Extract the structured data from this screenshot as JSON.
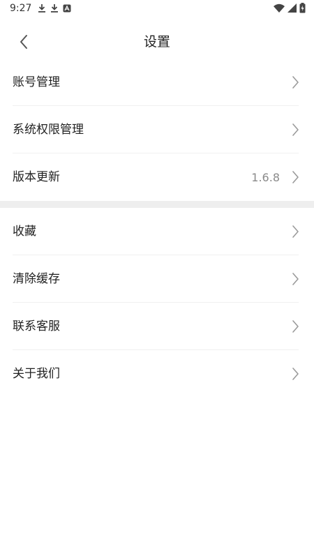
{
  "status_bar": {
    "time": "9:27",
    "left_icons": [
      "download-icon",
      "download-icon",
      "app-notification-icon"
    ],
    "right_icons": [
      "wifi-icon",
      "signal-icon",
      "battery-charging-icon"
    ]
  },
  "header": {
    "title": "设置",
    "back_icon": "chevron-left-icon"
  },
  "groups": [
    {
      "items": [
        {
          "label": "账号管理",
          "value": ""
        },
        {
          "label": "系统权限管理",
          "value": ""
        },
        {
          "label": "版本更新",
          "value": "1.6.8"
        }
      ]
    },
    {
      "items": [
        {
          "label": "收藏",
          "value": ""
        },
        {
          "label": "清除缓存",
          "value": ""
        },
        {
          "label": "联系客服",
          "value": ""
        },
        {
          "label": "关于我们",
          "value": ""
        }
      ]
    }
  ],
  "colors": {
    "divider_band": "#eeeeee",
    "chevron": "#9a9a9a",
    "value_text": "#8a8a8a"
  }
}
